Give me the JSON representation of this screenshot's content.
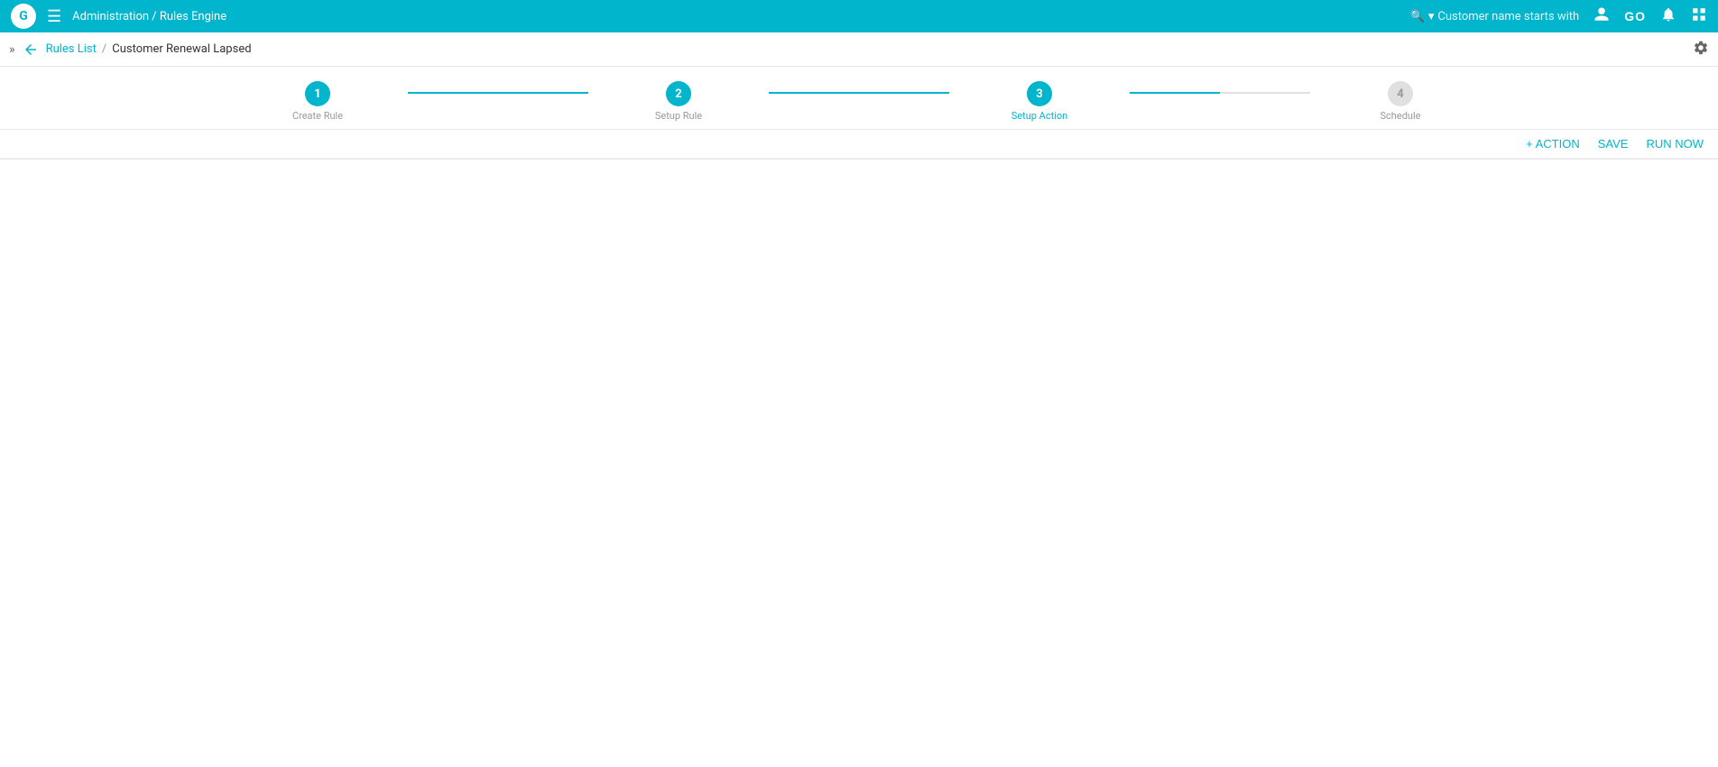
{
  "topbar": {
    "logo": "G",
    "menu_label": "☰",
    "title": "Administration / Rules Engine",
    "search_label": "🔍",
    "search_caret": "▾",
    "search_placeholder": "Customer name starts with",
    "user_icon": "👤",
    "go_label": "GO",
    "bell_icon": "🔔",
    "expand_icon": "⊞"
  },
  "breadcrumb": {
    "expand_label": "»",
    "back_label": "←",
    "rules_list_label": "Rules List",
    "separator": "/",
    "current_page": "Customer Renewal Lapsed",
    "settings_label": "⚙"
  },
  "stepper": {
    "steps": [
      {
        "number": "1",
        "label": "Create Rule",
        "state": "active"
      },
      {
        "number": "2",
        "label": "Setup Rule",
        "state": "active"
      },
      {
        "number": "3",
        "label": "Setup Action",
        "state": "active"
      },
      {
        "number": "4",
        "label": "Schedule",
        "state": "inactive"
      }
    ],
    "lines": [
      {
        "state": "completed"
      },
      {
        "state": "completed"
      },
      {
        "state": "partial"
      }
    ]
  },
  "toolbar": {
    "action_label": "+ ACTION",
    "save_label": "SAVE",
    "run_now_label": "RUN NOW"
  }
}
